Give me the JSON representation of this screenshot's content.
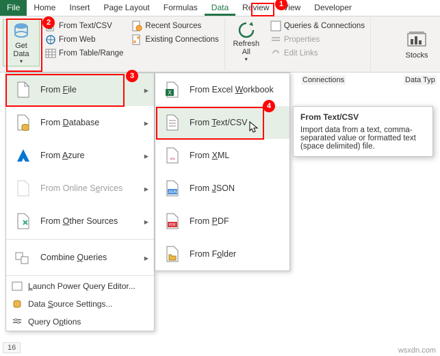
{
  "tabs": {
    "file": "File",
    "home": "Home",
    "insert": "Insert",
    "pagelayout": "Page Layout",
    "formulas": "Formulas",
    "data": "Data",
    "review": "Review",
    "view": "View",
    "developer": "Developer"
  },
  "ribbon": {
    "getdata": "Get\nData",
    "fromtextcsv": "From Text/CSV",
    "fromweb": "From Web",
    "fromtable": "From Table/Range",
    "recent": "Recent Sources",
    "existing": "Existing Connections",
    "refresh": "Refresh\nAll",
    "queries": "Queries & Connections",
    "properties": "Properties",
    "editlinks": "Edit Links",
    "stocks": "Stocks",
    "group_conn": "Connections",
    "group_dtype": "Data Typ"
  },
  "menu1": {
    "fromfile": "From File",
    "fromdb": "From Database",
    "fromazure": "From Azure",
    "fromonline": "From Online Services",
    "fromother": "From Other Sources",
    "combine": "Combine Queries",
    "launch": "Launch Power Query Editor...",
    "dss": "Data Source Settings...",
    "qopt": "Query Options"
  },
  "menu2": {
    "workbook": "From Excel Workbook",
    "textcsv": "From Text/CSV",
    "xml": "From XML",
    "json": "From JSON",
    "pdf": "From PDF",
    "folder": "From Folder"
  },
  "tooltip": {
    "title": "From Text/CSV",
    "body": "Import data from a text, comma-separated value or formatted text (space delimited) file."
  },
  "callouts": {
    "c1": "1",
    "c2": "2",
    "c3": "3",
    "c4": "4"
  },
  "row": "16",
  "watermark": "wsxdn.com"
}
